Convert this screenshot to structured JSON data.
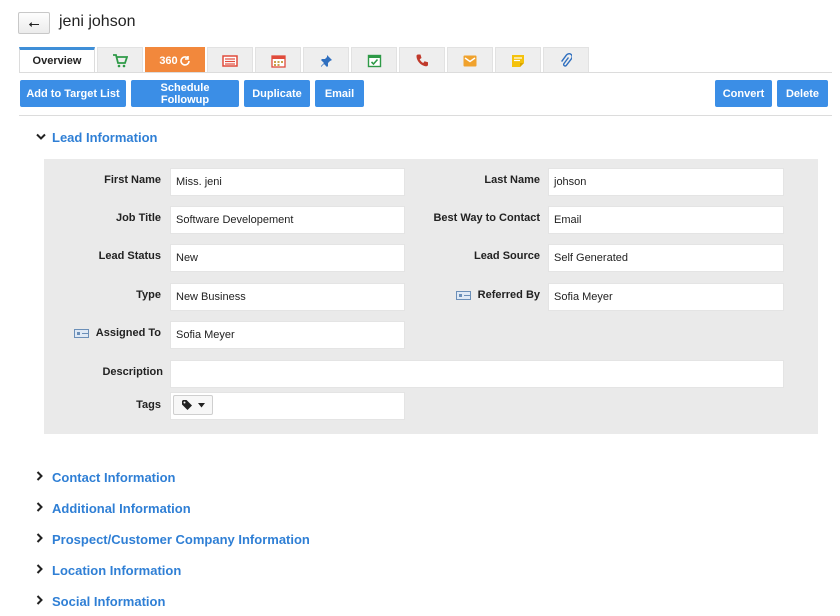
{
  "header": {
    "back_glyph": "⭠",
    "record_title": "jeni johson"
  },
  "tabs": [
    {
      "label": "Overview",
      "icon": "overview"
    },
    {
      "label": "",
      "icon": "cart-icon",
      "color": "#2e9a47"
    },
    {
      "label": "360",
      "icon": "refresh-icon",
      "color": "#f2883c"
    },
    {
      "label": "",
      "icon": "invoice-icon",
      "color": "#e04b3b"
    },
    {
      "label": "",
      "icon": "calendar-icon",
      "color": "#e04b3b"
    },
    {
      "label": "",
      "icon": "pin-icon",
      "color": "#2f6fbf"
    },
    {
      "label": "",
      "icon": "task-icon",
      "color": "#2e9a47"
    },
    {
      "label": "",
      "icon": "phone-icon",
      "color": "#c0392b"
    },
    {
      "label": "",
      "icon": "email-icon",
      "color": "#f0a22d"
    },
    {
      "label": "",
      "icon": "note-icon",
      "color": "#f4c20d"
    },
    {
      "label": "",
      "icon": "attachment-icon",
      "color": "#2f6fbf"
    }
  ],
  "actions": {
    "add_to_target_list": "Add to Target List",
    "schedule_followup": "Schedule Followup",
    "duplicate": "Duplicate",
    "email": "Email",
    "convert": "Convert",
    "delete": "Delete"
  },
  "lead_info": {
    "title": "Lead Information",
    "first_name_label": "First Name",
    "first_name": "Miss. jeni",
    "last_name_label": "Last Name",
    "last_name": "johson",
    "job_title_label": "Job Title",
    "job_title": "Software Developement",
    "best_way_label": "Best Way to Contact",
    "best_way": "Email",
    "lead_status_label": "Lead Status",
    "lead_status": "New",
    "lead_source_label": "Lead Source",
    "lead_source": "Self Generated",
    "type_label": "Type",
    "type": "New Business",
    "referred_by_label": "Referred By",
    "referred_by": "Sofia Meyer",
    "assigned_to_label": "Assigned To",
    "assigned_to": "Sofia Meyer",
    "description_label": "Description",
    "description": "",
    "tags_label": "Tags"
  },
  "sections": [
    "Contact Information",
    "Additional Information",
    "Prospect/Customer Company Information",
    "Location Information",
    "Social Information"
  ],
  "colors": {
    "accent": "#3b8ee6",
    "link": "#2f7fd5",
    "panel_bg": "#eaeaea",
    "tab_360": "#f2883c"
  }
}
